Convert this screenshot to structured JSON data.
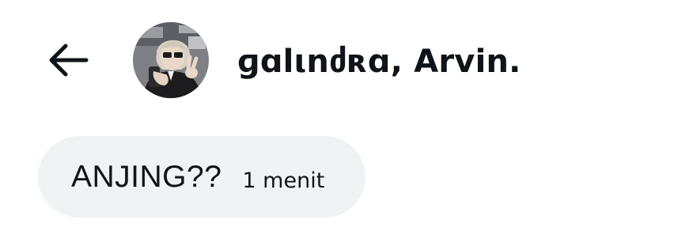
{
  "header": {
    "back_icon": "arrow-left-icon",
    "title": "ɡɑlιnძʀɑ, Arvin.",
    "avatar": {
      "icon": "profile-photo",
      "description_colors": {
        "background": "#7d7e83",
        "hair": "#d9d3c8",
        "jacket": "#1c1c1e"
      }
    }
  },
  "message": {
    "text": "ANJING??",
    "time": "1 menit",
    "bubble_color": "#eff3f4"
  }
}
